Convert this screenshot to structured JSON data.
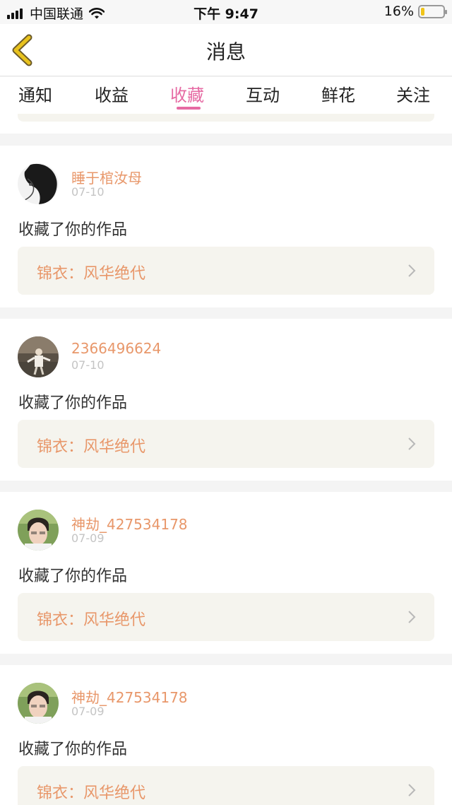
{
  "status_bar": {
    "carrier": "中国联通",
    "time": "下午 9:47",
    "battery": "16%",
    "icons": [
      "signal-icon",
      "wifi-icon",
      "battery-icon"
    ]
  },
  "header": {
    "title": "消息",
    "back_icon": "chevron-left-icon"
  },
  "tabs": [
    {
      "label": "通知"
    },
    {
      "label": "收益"
    },
    {
      "label": "收藏",
      "active": true
    },
    {
      "label": "互动"
    },
    {
      "label": "鲜花"
    },
    {
      "label": "关注"
    }
  ],
  "colors": {
    "accent": "#e66aa3",
    "name": "#e8976a",
    "work_bg": "#f5f4ee",
    "back_icon": "#e8c21d"
  },
  "messages": [
    {
      "username": "睡于棺汝母",
      "date": "07-10",
      "action": "收藏了你的作品",
      "work": "锦衣：风华绝代"
    },
    {
      "username": "2366496624",
      "date": "07-10",
      "action": "收藏了你的作品",
      "work": "锦衣：风华绝代"
    },
    {
      "username": "神劫_427534178",
      "date": "07-09",
      "action": "收藏了你的作品",
      "work": "锦衣：风华绝代"
    },
    {
      "username": "神劫_427534178",
      "date": "07-09",
      "action": "收藏了你的作品",
      "work": "锦衣：风华绝代"
    }
  ]
}
